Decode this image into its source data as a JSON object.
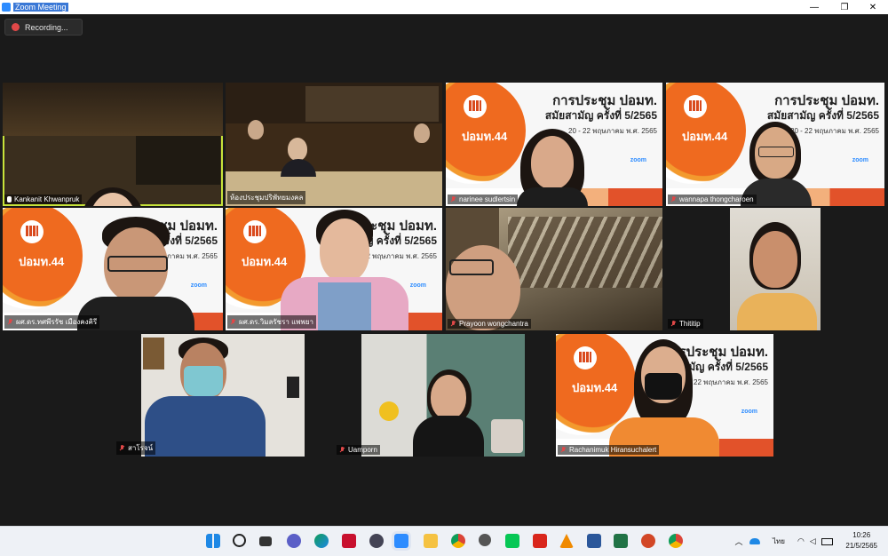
{
  "window": {
    "title": "Zoom Meeting"
  },
  "controls": {
    "minimize": "—",
    "restore": "❐",
    "close": "✕"
  },
  "recording": {
    "label": "Recording..."
  },
  "slide": {
    "line1": "การประชุม ปอมท.",
    "line2": "สมัยสามัญ ครั้งที่ 5/2565",
    "line3": "20 - 22 พฤษภาคม พ.ศ. 2565",
    "number": "ปอมท.44",
    "zoom": "zoom"
  },
  "participants": [
    {
      "name": "Kankanit Khwanpruk",
      "muted": false
    },
    {
      "name": "ห้องประชุมปริพัทยมงคล",
      "muted": false
    },
    {
      "name": "narinee sudlertsin",
      "muted": true
    },
    {
      "name": "wannapa thongcharoen",
      "muted": true
    },
    {
      "name": "ผศ.ดร.ทศพีรรัช เมืองคงคิรี",
      "muted": true
    },
    {
      "name": "ผศ.ดร.วิมลรัชรา แพพยา",
      "muted": true
    },
    {
      "name": "Prayoon wongchantra",
      "muted": true
    },
    {
      "name": "Thititip",
      "muted": true
    },
    {
      "name": "สาโรจน์",
      "muted": true
    },
    {
      "name": "Uamporn",
      "muted": true
    },
    {
      "name": "Rachanimuk Hiransuchalert",
      "muted": true
    }
  ],
  "taskbar": {
    "icons": [
      "windows-start",
      "search",
      "task-view",
      "teams",
      "edge",
      "mcafee",
      "camera",
      "zoom",
      "file-explorer",
      "chrome",
      "settings",
      "line",
      "acrobat",
      "vlc",
      "word",
      "excel",
      "powerpoint",
      "chrome-2"
    ],
    "lang": "ไทย",
    "time": "10:26",
    "date": "21/5/2565"
  },
  "colors": {
    "active_border": "#c7e33a",
    "accent": "#2d8cff",
    "mute_red": "#e04848",
    "slide_orange": "#ef6a1f"
  }
}
